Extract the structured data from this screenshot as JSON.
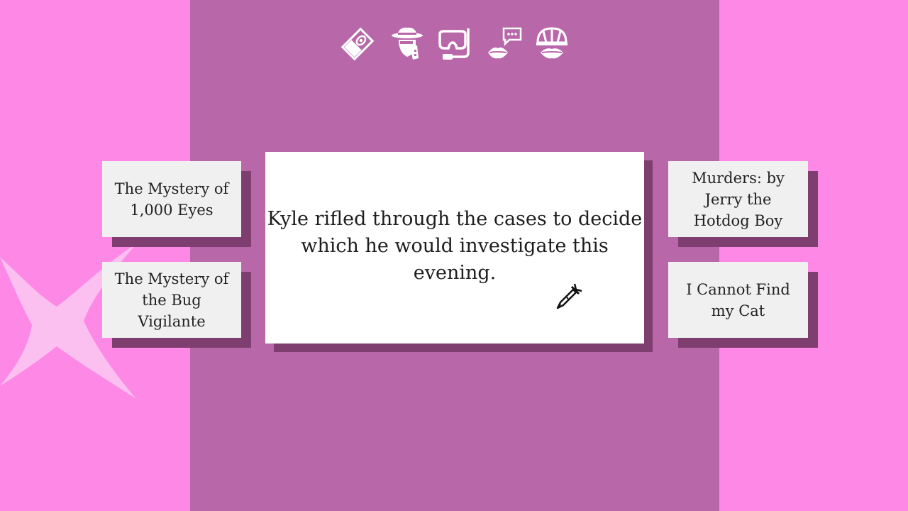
{
  "icons": [
    {
      "name": "casefile-icon",
      "label": "case file"
    },
    {
      "name": "detective-icon",
      "label": "detective"
    },
    {
      "name": "snorkel-icon",
      "label": "snorkel"
    },
    {
      "name": "chat-lips-icon",
      "label": "talk"
    },
    {
      "name": "helmet-lips-icon",
      "label": "helmet"
    }
  ],
  "narration": {
    "text": "Kyle rifled through the cases to decide which he would investigate this evening."
  },
  "cases": {
    "left_top": "The Mystery of 1,000 Eyes",
    "left_bottom": "The Mystery of the Bug Vigilante",
    "right_top": "Murders: by Jerry the Hotdog Boy",
    "right_bottom": "I Cannot Find my Cat"
  },
  "colors": {
    "background": "#fd88e6",
    "panel": "#b867a9",
    "card": "#f0f0f0",
    "shadow": "#7f3e70"
  }
}
